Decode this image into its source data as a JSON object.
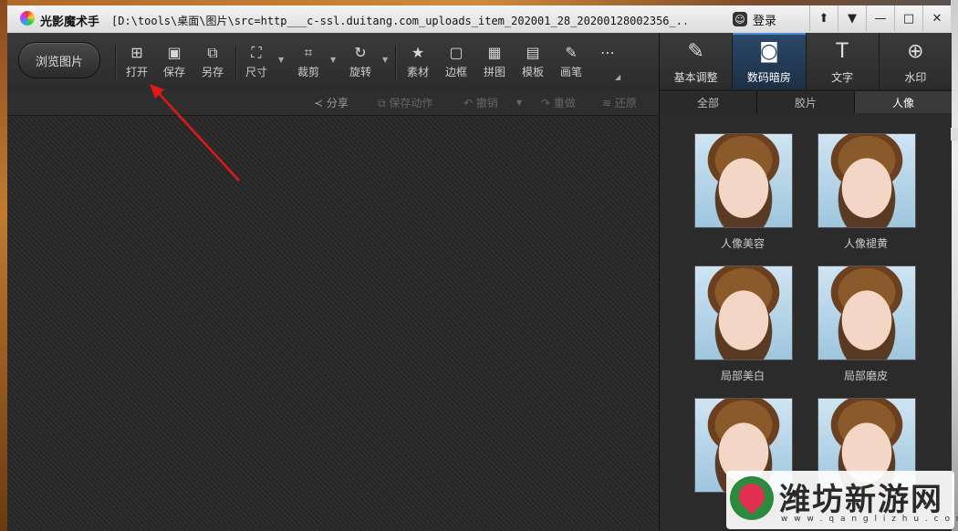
{
  "window": {
    "app_name": "光影魔术手",
    "path": "[D:\\tools\\桌面\\图片\\src=http___c-ssl.duitang.com_uploads_item_202001_28_20200128002356_...",
    "login_label": "登录",
    "smile_glyph": "☺",
    "buttons": {
      "skin": "⬆",
      "menu": "▼",
      "minimize": "—",
      "maximize": "□",
      "close": "✕"
    }
  },
  "toolbar": {
    "browse_label": "浏览图片",
    "tools": [
      {
        "label": "打开",
        "icon": "⊞"
      },
      {
        "label": "保存",
        "icon": "▣"
      },
      {
        "label": "另存",
        "icon": "⧉"
      },
      {
        "label": "尺寸",
        "icon": "⛶"
      },
      {
        "label": "裁剪",
        "icon": "⌗"
      },
      {
        "label": "旋转",
        "icon": "↻"
      },
      {
        "label": "素材",
        "icon": "★"
      },
      {
        "label": "边框",
        "icon": "▢"
      },
      {
        "label": "拼图",
        "icon": "▦"
      },
      {
        "label": "模板",
        "icon": "▤"
      },
      {
        "label": "画笔",
        "icon": "✎"
      },
      {
        "label": "",
        "icon": "⋯"
      }
    ],
    "more_glyph": "◢",
    "dropdown_glyph": "▼"
  },
  "actions": {
    "share": "分享",
    "save_action": "保存动作",
    "undo": "撤销",
    "redo": "重做",
    "restore": "还原"
  },
  "right_tabs": [
    {
      "label": "基本调整",
      "icon": "✎"
    },
    {
      "label": "数码暗房",
      "icon": "◙"
    },
    {
      "label": "文字",
      "icon": "T"
    },
    {
      "label": "水印",
      "icon": "⊕"
    }
  ],
  "filter_tabs": [
    "全部",
    "胶片",
    "人像"
  ],
  "effects": [
    "人像美容",
    "人像褪黄",
    "局部美白",
    "局部磨皮",
    "",
    ""
  ],
  "watermark": {
    "name": "潍坊新游网",
    "url": "w w w . q a n g l i z h u . c o m"
  }
}
